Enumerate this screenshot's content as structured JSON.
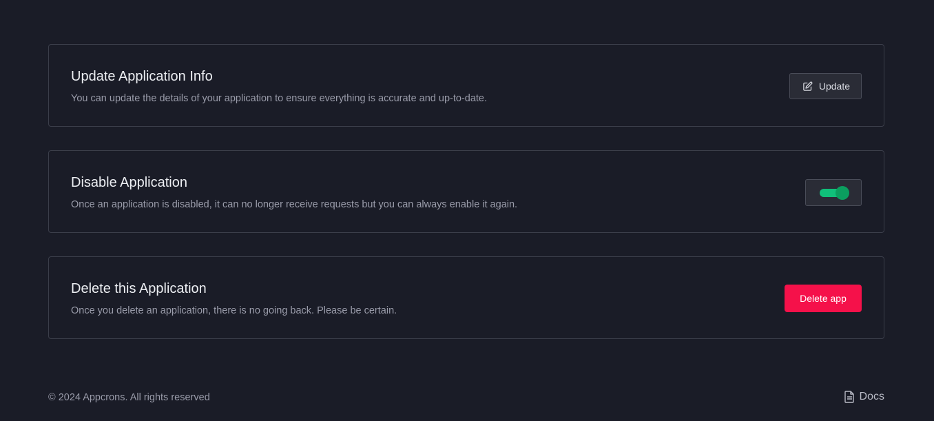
{
  "sections": {
    "update": {
      "title": "Update Application Info",
      "description": "You can update the details of your application to ensure everything is accurate and up-to-date.",
      "button_label": "Update",
      "button_icon": "edit-icon"
    },
    "disable": {
      "title": "Disable Application",
      "description": "Once an application is disabled, it can no longer receive requests but you can always enable it again.",
      "toggle_on": true,
      "toggle_color": "#10c07a"
    },
    "delete": {
      "title": "Delete this Application",
      "description": "Once you delete an application, there is no going back. Please be certain.",
      "button_label": "Delete app",
      "button_color": "#f5114a"
    }
  },
  "footer": {
    "copyright": "© 2024 Appcrons. All rights reserved",
    "docs_label": "Docs",
    "docs_icon": "document-icon"
  },
  "colors": {
    "background": "#1a1c27",
    "card_border": "#3b3e4a",
    "muted_text": "#9a9caa"
  }
}
